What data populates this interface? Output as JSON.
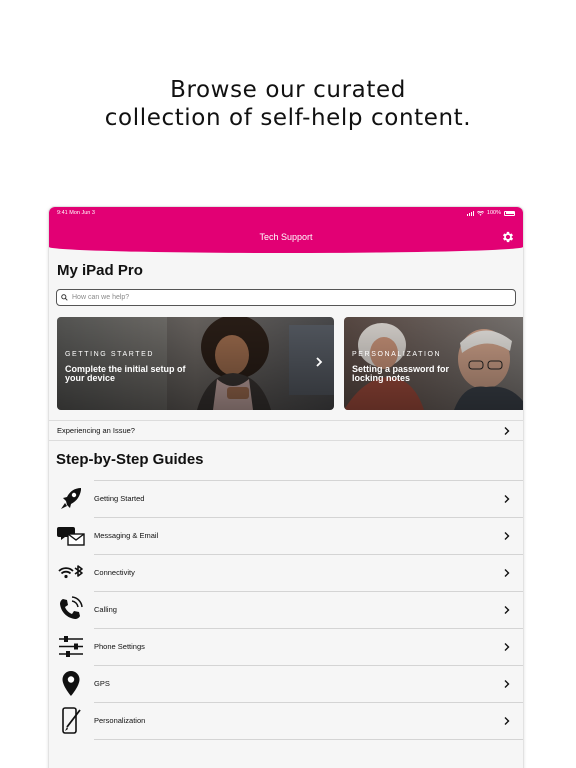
{
  "headline": {
    "line1": "Browse our curated",
    "line2": "collection of self-help content."
  },
  "status_bar": {
    "time_date": "9:41  Mon Jun 3",
    "battery": "100%"
  },
  "app": {
    "title": "Tech Support",
    "accent_color": "#e20074"
  },
  "device_title": "My iPad Pro",
  "search": {
    "placeholder": "How can we help?"
  },
  "cards": [
    {
      "eyebrow": "GETTING STARTED",
      "text": "Complete the initial setup of your device",
      "icon": "chevron-right-icon"
    },
    {
      "eyebrow": "PERSONALIZATION",
      "text": "Setting a password for locking notes"
    }
  ],
  "issue_row": {
    "label": "Experiencing an Issue?"
  },
  "guides": {
    "title": "Step-by-Step Guides",
    "items": [
      {
        "label": "Getting Started",
        "icon": "rocket-icon"
      },
      {
        "label": "Messaging & Email",
        "icon": "chat-email-icon"
      },
      {
        "label": "Connectivity",
        "icon": "wifi-bluetooth-icon"
      },
      {
        "label": "Calling",
        "icon": "phone-icon"
      },
      {
        "label": "Phone Settings",
        "icon": "sliders-icon"
      },
      {
        "label": "GPS",
        "icon": "map-pin-icon"
      },
      {
        "label": "Personalization",
        "icon": "phone-brush-icon"
      }
    ]
  }
}
